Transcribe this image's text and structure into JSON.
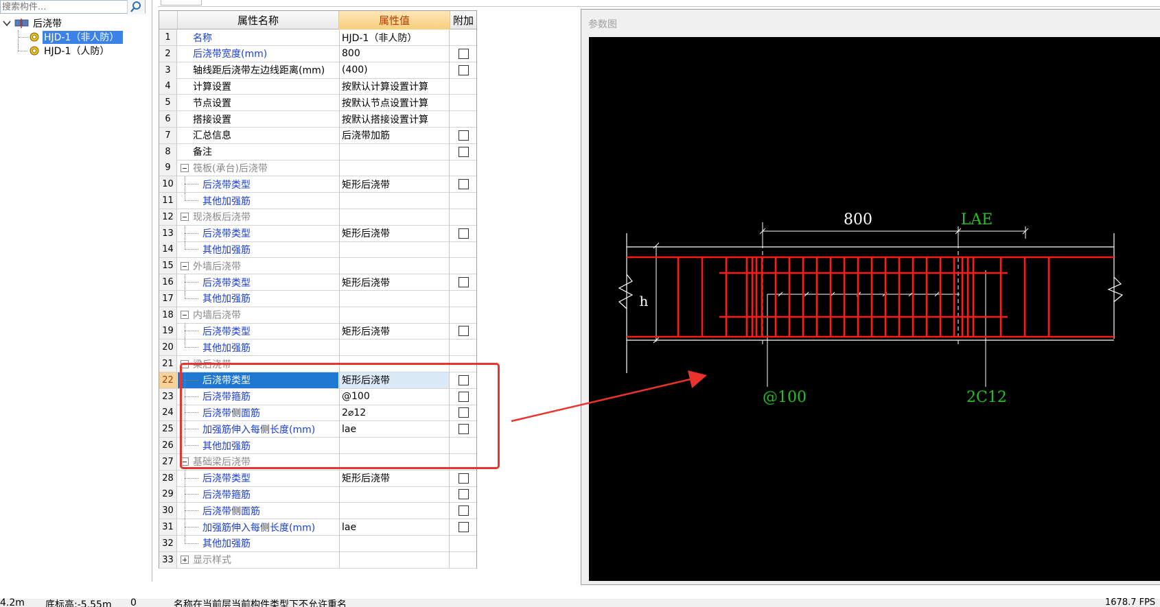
{
  "search": {
    "placeholder": "搜索构件..."
  },
  "tree": {
    "root_label": "后浇带",
    "items": [
      {
        "label": "HJD-1（非人防）",
        "selected": true
      },
      {
        "label": "HJD-1（人防）",
        "selected": false
      }
    ]
  },
  "grid": {
    "headers": {
      "name": "属性名称",
      "value": "属性值",
      "extra": "附加"
    },
    "rows": [
      {
        "num": "1",
        "name": "名称",
        "value": "HJD-1（非人防）",
        "style": "blue",
        "checkbox": false
      },
      {
        "num": "2",
        "name": "后浇带宽度(mm)",
        "value": "800",
        "style": "blue",
        "checkbox": true
      },
      {
        "num": "3",
        "name": "轴线距后浇带左边线距离(mm)",
        "value": "(400)",
        "style": "plain",
        "checkbox": true
      },
      {
        "num": "4",
        "name": "计算设置",
        "value": "按默认计算设置计算",
        "style": "plain",
        "checkbox": false
      },
      {
        "num": "5",
        "name": "节点设置",
        "value": "按默认节点设置计算",
        "style": "plain",
        "checkbox": false
      },
      {
        "num": "6",
        "name": "搭接设置",
        "value": "按默认搭接设置计算",
        "style": "plain",
        "checkbox": false
      },
      {
        "num": "7",
        "name": "汇总信息",
        "value": "后浇带加筋",
        "style": "plain",
        "checkbox": true
      },
      {
        "num": "8",
        "name": "备注",
        "value": "",
        "style": "plain",
        "checkbox": true
      },
      {
        "num": "9",
        "name": "筏板(承台)后浇带",
        "value": "",
        "style": "group",
        "checkbox": false
      },
      {
        "num": "10",
        "name": "后浇带类型",
        "value": "矩形后浇带",
        "style": "child",
        "checkbox": true
      },
      {
        "num": "11",
        "name": "其他加强筋",
        "value": "",
        "style": "child-last",
        "checkbox": false
      },
      {
        "num": "12",
        "name": "现浇板后浇带",
        "value": "",
        "style": "group",
        "checkbox": false
      },
      {
        "num": "13",
        "name": "后浇带类型",
        "value": "矩形后浇带",
        "style": "child",
        "checkbox": true
      },
      {
        "num": "14",
        "name": "其他加强筋",
        "value": "",
        "style": "child-last",
        "checkbox": false
      },
      {
        "num": "15",
        "name": "外墙后浇带",
        "value": "",
        "style": "group",
        "checkbox": false
      },
      {
        "num": "16",
        "name": "后浇带类型",
        "value": "矩形后浇带",
        "style": "child",
        "checkbox": true
      },
      {
        "num": "17",
        "name": "其他加强筋",
        "value": "",
        "style": "child-last",
        "checkbox": false
      },
      {
        "num": "18",
        "name": "内墙后浇带",
        "value": "",
        "style": "group",
        "checkbox": false
      },
      {
        "num": "19",
        "name": "后浇带类型",
        "value": "矩形后浇带",
        "style": "child",
        "checkbox": true
      },
      {
        "num": "20",
        "name": "其他加强筋",
        "value": "",
        "style": "child-last",
        "checkbox": false
      },
      {
        "num": "21",
        "name": "梁后浇带",
        "value": "",
        "style": "group",
        "checkbox": false
      },
      {
        "num": "22",
        "name": "后浇带类型",
        "value": "矩形后浇带",
        "style": "child-selected",
        "checkbox": true
      },
      {
        "num": "23",
        "name": "后浇带箍筋",
        "value": "@100",
        "style": "child",
        "checkbox": true
      },
      {
        "num": "24",
        "name": "后浇带侧面筋",
        "value": "2⌀12",
        "style": "child",
        "checkbox": true
      },
      {
        "num": "25",
        "name": "加强筋伸入每侧长度(mm)",
        "value": "lae",
        "style": "child",
        "checkbox": true
      },
      {
        "num": "26",
        "name": "其他加强筋",
        "value": "",
        "style": "child-last",
        "checkbox": false
      },
      {
        "num": "27",
        "name": "基础梁后浇带",
        "value": "",
        "style": "group",
        "checkbox": false
      },
      {
        "num": "28",
        "name": "后浇带类型",
        "value": "矩形后浇带",
        "style": "child",
        "checkbox": true
      },
      {
        "num": "29",
        "name": "后浇带箍筋",
        "value": "",
        "style": "child",
        "checkbox": true
      },
      {
        "num": "30",
        "name": "后浇带侧面筋",
        "value": "",
        "style": "child",
        "checkbox": true
      },
      {
        "num": "31",
        "name": "加强筋伸入每侧长度(mm)",
        "value": "lae",
        "style": "child",
        "checkbox": true
      },
      {
        "num": "32",
        "name": "其他加强筋",
        "value": "",
        "style": "child-last",
        "checkbox": false
      },
      {
        "num": "33",
        "name": "显示样式",
        "value": "",
        "style": "group-collapsed",
        "checkbox": false
      }
    ]
  },
  "figure": {
    "title": "参数图",
    "labels": {
      "width": "800",
      "lae": "LAE",
      "height": "h",
      "stirrup": "@100",
      "side_bar": "2C12"
    },
    "colors": {
      "background": "#000000",
      "rebar": "#ff1a1a",
      "dimension": "#ffffff",
      "annotation": "#22c222"
    }
  },
  "status": {
    "elevation_top": "4.2m",
    "elevation_bottom": "底标高:-5.55m",
    "count": "0",
    "message": "名称在当前层当前构件类型下不允许重名",
    "fps": "1678.7 FPS"
  },
  "annotations": {
    "highlight_color": "#e8342c"
  }
}
